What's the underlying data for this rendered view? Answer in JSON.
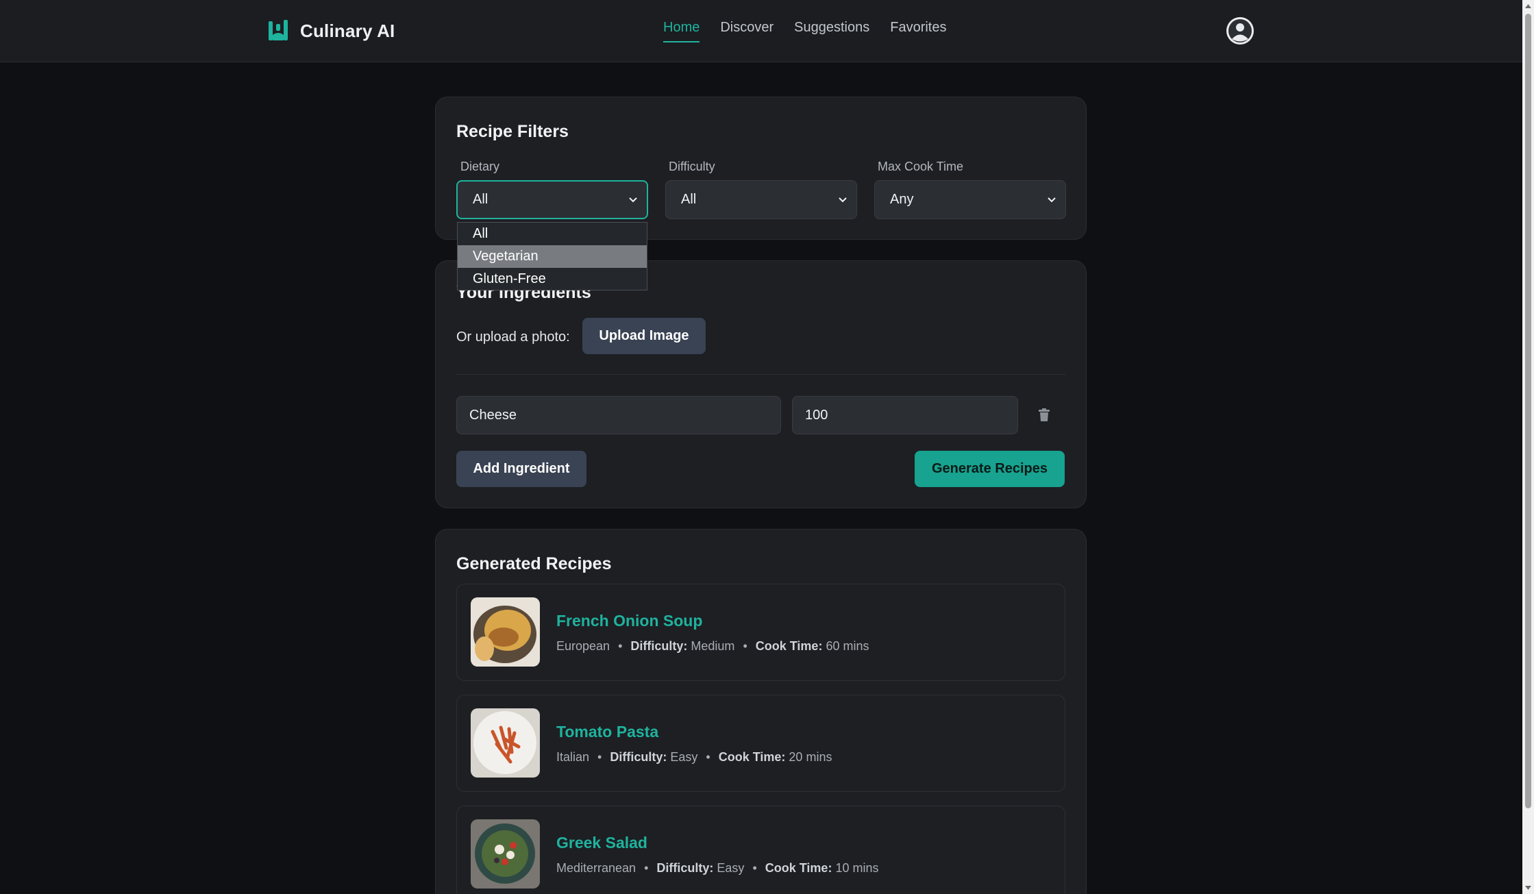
{
  "app": {
    "name": "Culinary AI"
  },
  "colors": {
    "accent": "#1fb39e",
    "background": "#0e1013",
    "card": "#1d1f23",
    "button_dark": "#3a4353"
  },
  "nav": {
    "links": [
      {
        "label": "Home",
        "active": true
      },
      {
        "label": "Discover",
        "active": false
      },
      {
        "label": "Suggestions",
        "active": false
      },
      {
        "label": "Favorites",
        "active": false
      }
    ],
    "profile_icon": "user-circle-icon"
  },
  "filters": {
    "title": "Recipe Filters",
    "dietary": {
      "label": "Dietary",
      "value": "All",
      "options": [
        "All",
        "Vegetarian",
        "Gluten-Free"
      ],
      "highlighted": "Vegetarian",
      "open": true
    },
    "difficulty": {
      "label": "Difficulty",
      "value": "All"
    },
    "max_cook_time": {
      "label": "Max Cook Time",
      "value": "Any"
    }
  },
  "ingredients": {
    "title": "Your Ingredients",
    "upload_label": "Or upload a photo:",
    "upload_button": "Upload Image",
    "rows": [
      {
        "name": "Cheese",
        "amount": "100"
      }
    ],
    "delete_icon": "trash-icon",
    "add_button": "Add Ingredient",
    "generate_button": "Generate Recipes"
  },
  "recipes": {
    "title": "Generated Recipes",
    "difficulty_label": "Difficulty:",
    "cook_time_label": "Cook Time:",
    "items": [
      {
        "name": "French Onion Soup",
        "cuisine": "European",
        "difficulty": "Medium",
        "cook_time": "60 mins",
        "thumbnail": "soup-photo"
      },
      {
        "name": "Tomato Pasta",
        "cuisine": "Italian",
        "difficulty": "Easy",
        "cook_time": "20 mins",
        "thumbnail": "pasta-photo"
      },
      {
        "name": "Greek Salad",
        "cuisine": "Mediterranean",
        "difficulty": "Easy",
        "cook_time": "10 mins",
        "thumbnail": "salad-photo"
      }
    ]
  }
}
